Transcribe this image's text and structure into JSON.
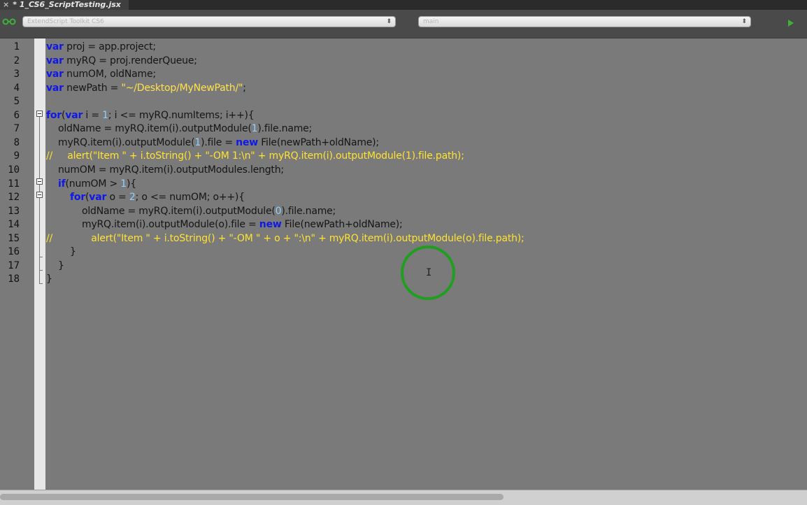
{
  "tab": {
    "close_glyph": "×",
    "title": "* 1_CS6_ScriptTesting.jsx"
  },
  "toolbar": {
    "target_select": "ExtendScript Toolkit CS6",
    "function_select": "main",
    "icons": [
      "link-icon",
      "run-icon"
    ]
  },
  "editor": {
    "lines": [
      {
        "n": "1",
        "tokens": [
          {
            "t": "var",
            "c": "kw"
          },
          {
            "t": " proj = app.project;",
            "c": "txt"
          }
        ]
      },
      {
        "n": "2",
        "tokens": [
          {
            "t": "var",
            "c": "kw"
          },
          {
            "t": " myRQ = proj.renderQueue;",
            "c": "txt"
          }
        ]
      },
      {
        "n": "3",
        "tokens": [
          {
            "t": "var",
            "c": "kw"
          },
          {
            "t": " numOM, oldName;",
            "c": "txt"
          }
        ]
      },
      {
        "n": "4",
        "tokens": [
          {
            "t": "var",
            "c": "kw"
          },
          {
            "t": " newPath = ",
            "c": "txt"
          },
          {
            "t": "\"~/Desktop/MyNewPath/\"",
            "c": "str"
          },
          {
            "t": ";",
            "c": "txt"
          }
        ]
      },
      {
        "n": "5",
        "tokens": []
      },
      {
        "n": "6",
        "tokens": [
          {
            "t": "for",
            "c": "kw"
          },
          {
            "t": "(",
            "c": "txt"
          },
          {
            "t": "var",
            "c": "kw"
          },
          {
            "t": " i = ",
            "c": "txt"
          },
          {
            "t": "1",
            "c": "num"
          },
          {
            "t": "; i <= myRQ.numItems; i++){",
            "c": "txt"
          }
        ]
      },
      {
        "n": "7",
        "tokens": [
          {
            "t": "    oldName = myRQ.item(i).outputModule(",
            "c": "txt"
          },
          {
            "t": "1",
            "c": "num"
          },
          {
            "t": ").file.name;",
            "c": "txt"
          }
        ]
      },
      {
        "n": "8",
        "tokens": [
          {
            "t": "    myRQ.item(i).outputModule(",
            "c": "txt"
          },
          {
            "t": "1",
            "c": "num"
          },
          {
            "t": ").file = ",
            "c": "txt"
          },
          {
            "t": "new",
            "c": "kw"
          },
          {
            "t": " File(newPath+oldName);",
            "c": "txt"
          }
        ]
      },
      {
        "n": "9",
        "tokens": [
          {
            "t": "//     alert(\"Item \" + i.toString() + \"-OM 1:\\n\" + myRQ.item(i).outputModule(1).file.path);",
            "c": "cm"
          }
        ]
      },
      {
        "n": "10",
        "tokens": [
          {
            "t": "    numOM = myRQ.item(i).outputModules.length;",
            "c": "txt"
          }
        ]
      },
      {
        "n": "11",
        "tokens": [
          {
            "t": "    ",
            "c": "txt"
          },
          {
            "t": "if",
            "c": "kw"
          },
          {
            "t": "(numOM > ",
            "c": "txt"
          },
          {
            "t": "1",
            "c": "num"
          },
          {
            "t": "){",
            "c": "txt"
          }
        ]
      },
      {
        "n": "12",
        "tokens": [
          {
            "t": "        ",
            "c": "txt"
          },
          {
            "t": "for",
            "c": "kw"
          },
          {
            "t": "(",
            "c": "txt"
          },
          {
            "t": "var",
            "c": "kw"
          },
          {
            "t": " o = ",
            "c": "txt"
          },
          {
            "t": "2",
            "c": "num"
          },
          {
            "t": "; o <= numOM; o++){",
            "c": "txt"
          }
        ]
      },
      {
        "n": "13",
        "tokens": [
          {
            "t": "            oldName = myRQ.item(i).outputModule(",
            "c": "txt"
          },
          {
            "t": "0",
            "c": "num"
          },
          {
            "t": ").file.name;",
            "c": "txt"
          }
        ]
      },
      {
        "n": "14",
        "tokens": [
          {
            "t": "            myRQ.item(i).outputModule(o).file = ",
            "c": "txt"
          },
          {
            "t": "new",
            "c": "kw"
          },
          {
            "t": " File(newPath+oldName);",
            "c": "txt"
          }
        ]
      },
      {
        "n": "15",
        "tokens": [
          {
            "t": "//             alert(\"Item \" + i.toString() + \"-OM \" + o + \":\\n\" + myRQ.item(i).outputModule(o).file.path);",
            "c": "cm"
          }
        ]
      },
      {
        "n": "16",
        "tokens": [
          {
            "t": "        }",
            "c": "txt"
          }
        ]
      },
      {
        "n": "17",
        "tokens": [
          {
            "t": "    }",
            "c": "txt"
          }
        ]
      },
      {
        "n": "18",
        "tokens": [
          {
            "t": "}",
            "c": "txt"
          }
        ]
      }
    ]
  },
  "colors": {
    "keyword": "#1018e6",
    "number": "#8fd0ff",
    "string": "#ffe14d",
    "comment": "#ffe32e",
    "cursor_ring": "#1f9e1f"
  },
  "cursor": {
    "glyph": "I",
    "icon": "ibeam-cursor-icon"
  }
}
